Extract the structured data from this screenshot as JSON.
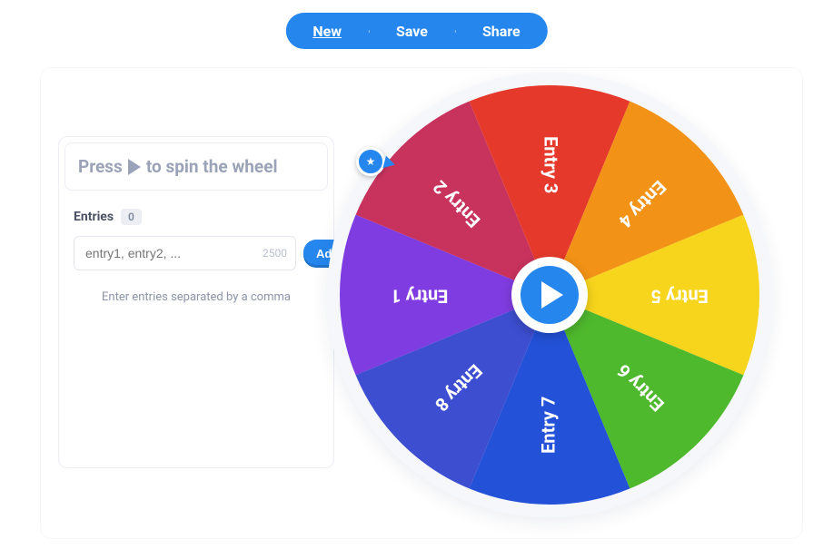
{
  "topbar": {
    "new": "New",
    "save": "Save",
    "share": "Share"
  },
  "panel": {
    "hint_prefix": "Press",
    "hint_suffix": "to spin the wheel",
    "entries_label": "Entries",
    "entries_count": "0",
    "input_placeholder": "entry1, entry2, ...",
    "input_limit": "2500",
    "add_label": "Add",
    "help_text": "Enter entries separated by a comma"
  },
  "wheel": {
    "segments": [
      {
        "label": "Entry 1",
        "color": "#7f3ce0"
      },
      {
        "label": "Entry 2",
        "color": "#c8335e"
      },
      {
        "label": "Entry 3",
        "color": "#e53a2b"
      },
      {
        "label": "Entry 4",
        "color": "#f29217"
      },
      {
        "label": "Entry 5",
        "color": "#f7d51c"
      },
      {
        "label": "Entry 6",
        "color": "#4fb92e"
      },
      {
        "label": "Entry 7",
        "color": "#2351d8"
      },
      {
        "label": "Entry 8",
        "color": "#3d4ed0"
      }
    ]
  }
}
